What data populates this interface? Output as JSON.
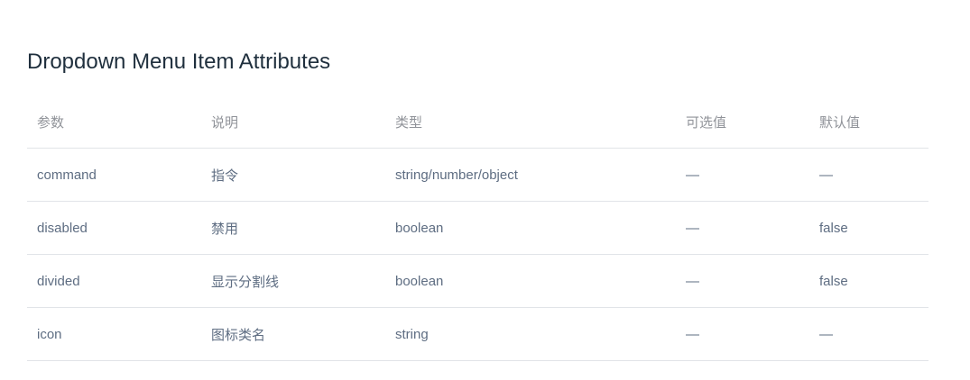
{
  "title": "Dropdown Menu Item Attributes",
  "table": {
    "headers": [
      "参数",
      "说明",
      "类型",
      "可选值",
      "默认值"
    ],
    "rows": [
      [
        "command",
        "指令",
        "string/number/object",
        "—",
        "—"
      ],
      [
        "disabled",
        "禁用",
        "boolean",
        "—",
        "false"
      ],
      [
        "divided",
        "显示分割线",
        "boolean",
        "—",
        "false"
      ],
      [
        "icon",
        "图标类名",
        "string",
        "—",
        "—"
      ]
    ]
  }
}
